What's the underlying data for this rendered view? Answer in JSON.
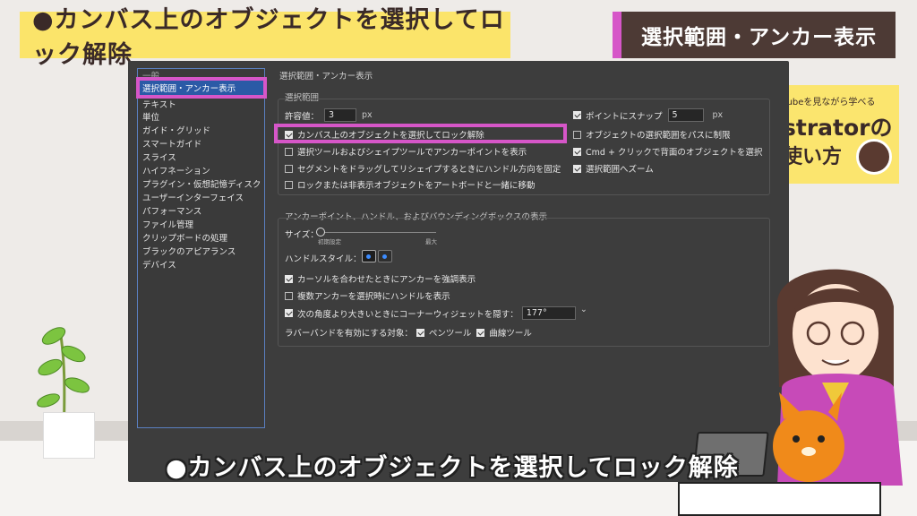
{
  "banner": {
    "title": "●カンバス上のオブジェクトを選択してロック解除",
    "section": "選択範囲・アンカー表示"
  },
  "logo": {
    "line1": "Tubeを見ながら学べる",
    "line2": "strator",
    "line2b": "の",
    "line3": "使い方"
  },
  "dialog": {
    "title": "選択範囲・アンカー表示",
    "sidebar": {
      "partial_top": "一般",
      "selected": "選択範囲・アンカー表示",
      "items": [
        "テキスト",
        "単位",
        "ガイド・グリッド",
        "スマートガイド",
        "スライス",
        "ハイフネーション",
        "プラグイン・仮想記憶ディスク",
        "ユーザーインターフェイス",
        "パフォーマンス",
        "ファイル管理",
        "クリップボードの処理",
        "ブラックのアピアランス",
        "デバイス"
      ]
    },
    "selection": {
      "group_label": "選択範囲",
      "tolerance_label": "許容値：",
      "tolerance_value": "3",
      "tolerance_unit": "px",
      "snap_label": "ポイントにスナップ",
      "snap_value": "5",
      "snap_unit": "px",
      "options_left": [
        {
          "label": "カンバス上のオブジェクトを選択してロック解除",
          "checked": true
        },
        {
          "label": "選択ツールおよびシェイプツールでアンカーポイントを表示",
          "checked": false
        },
        {
          "label": "セグメントをドラッグしてリシェイプするときにハンドル方向を固定",
          "checked": false
        },
        {
          "label": "ロックまたは非表示オブジェクトをアートボードと一緒に移動",
          "checked": false
        }
      ],
      "options_right": [
        {
          "label": "オブジェクトの選択範囲をパスに制限",
          "checked": false
        },
        {
          "label": "Cmd + クリックで背面のオブジェクトを選択",
          "checked": true
        },
        {
          "label": "選択範囲へズーム",
          "checked": true
        }
      ]
    },
    "anchor": {
      "group_label": "アンカーポイント、ハンドル、およびバウンディングボックスの表示",
      "size_label": "サイズ：",
      "size_min": "初期設定",
      "size_max": "最大",
      "handle_style_label": "ハンドルスタイル：",
      "options": [
        {
          "label": "カーソルを合わせたときにアンカーを強調表示",
          "checked": true
        },
        {
          "label": "複数アンカーを選択時にハンドルを表示",
          "checked": false
        },
        {
          "label": "次の角度より大きいときにコーナーウィジェットを隠す：",
          "checked": true
        }
      ],
      "angle_value": "177°",
      "rubberband_label": "ラバーバンドを有効にする対象：",
      "pen_tool": "ペンツール",
      "curve_tool": "曲線ツール",
      "pen_checked": true,
      "curve_checked": true
    }
  },
  "caption": "●カンバス上のオブジェクトを選択してロック解除",
  "colors": {
    "accent": "#d656c8",
    "banner_yellow": "#fbe46a",
    "banner_brown": "#4d3a35",
    "selection_blue": "#2b5aa6"
  }
}
